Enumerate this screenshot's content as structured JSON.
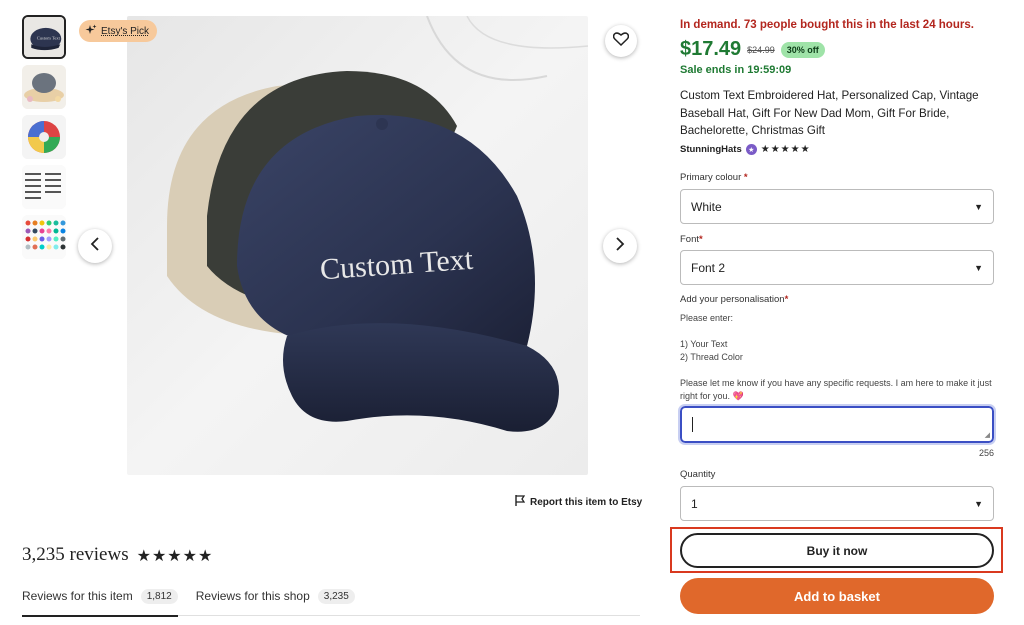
{
  "gallery": {
    "badge_label": "Etsy's Pick",
    "badge_icon": "sparkle-icon",
    "image_text": "Custom Text",
    "thumbnails": [
      "hat-navy",
      "hat-grey-flowers",
      "hat-colors-fan",
      "text-options",
      "color-chart"
    ]
  },
  "report_label": "Report this item to Etsy",
  "reviews": {
    "title": "3,235 reviews",
    "stars": "★★★★★",
    "tabs": [
      {
        "label": "Reviews for this item",
        "count": "1,812"
      },
      {
        "label": "Reviews for this shop",
        "count": "3,235"
      }
    ]
  },
  "product": {
    "demand_text": "In demand. 73 people bought this in the last 24 hours.",
    "price": "$17.49",
    "original_price": "$24.99",
    "discount": "30% off",
    "sale_text": "Sale ends in 19:59:09",
    "title": "Custom Text Embroidered Hat, Personalized Cap, Vintage Baseball Hat, Gift For New Dad Mom, Gift For Bride, Bachelorette, Christmas Gift",
    "shop_name": "StunningHats",
    "shop_stars": "★★★★★"
  },
  "options": {
    "colour_label": "Primary colour",
    "colour_value": "White",
    "font_label": "Font",
    "font_value": "Font 2",
    "personalisation_label": "Add your personalisation",
    "instructions": {
      "line1": "Please enter:",
      "line2": "1) Your Text",
      "line3": "2) Thread Color",
      "line4": "Please let me know if you have any specific requests. I am here to make it just right for you. 💖"
    },
    "char_count": "256",
    "quantity_label": "Quantity",
    "quantity_value": "1",
    "required_mark": "*"
  },
  "actions": {
    "buy_now": "Buy it now",
    "add_to_basket": "Add to basket"
  },
  "colors": {
    "price_green": "#1f7a33",
    "demand_red": "#b3261e",
    "basket_orange": "#e0682b",
    "focus_blue": "#3b4fc4",
    "highlight_red": "#d9391f"
  }
}
